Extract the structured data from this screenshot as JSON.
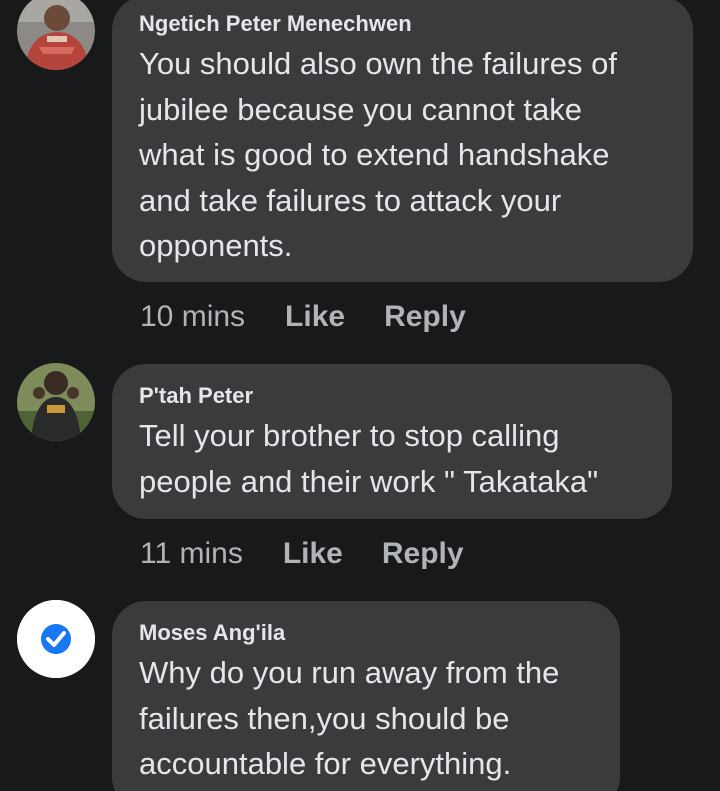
{
  "comments": [
    {
      "author": "Ngetich Peter Menechwen",
      "lines": [
        "You should also own the failures of",
        "jubilee because you cannot take",
        "what is good to extend handshake",
        "and take failures to attack your",
        "opponents."
      ],
      "time": "10 mins",
      "like_label": "Like",
      "reply_label": "Reply",
      "avatar_icon": "person-photo-icon"
    },
    {
      "author": "P'tah Peter",
      "lines": [
        "Tell your brother to stop calling",
        "people and their work \" Takataka\""
      ],
      "time": "11 mins",
      "like_label": "Like",
      "reply_label": "Reply",
      "avatar_icon": "person-photo-icon"
    },
    {
      "author": "Moses Ang'ila",
      "lines": [
        "Why do you run away from the",
        "failures then,you should be",
        "accountable for everything."
      ],
      "avatar_icon": "verified-check-icon"
    }
  ],
  "colors": {
    "background": "#18191a",
    "bubble": "#3a3b3c",
    "text": "#e4e6eb",
    "secondary_text": "#b0b3b8",
    "verified_blue": "#1877f2"
  }
}
